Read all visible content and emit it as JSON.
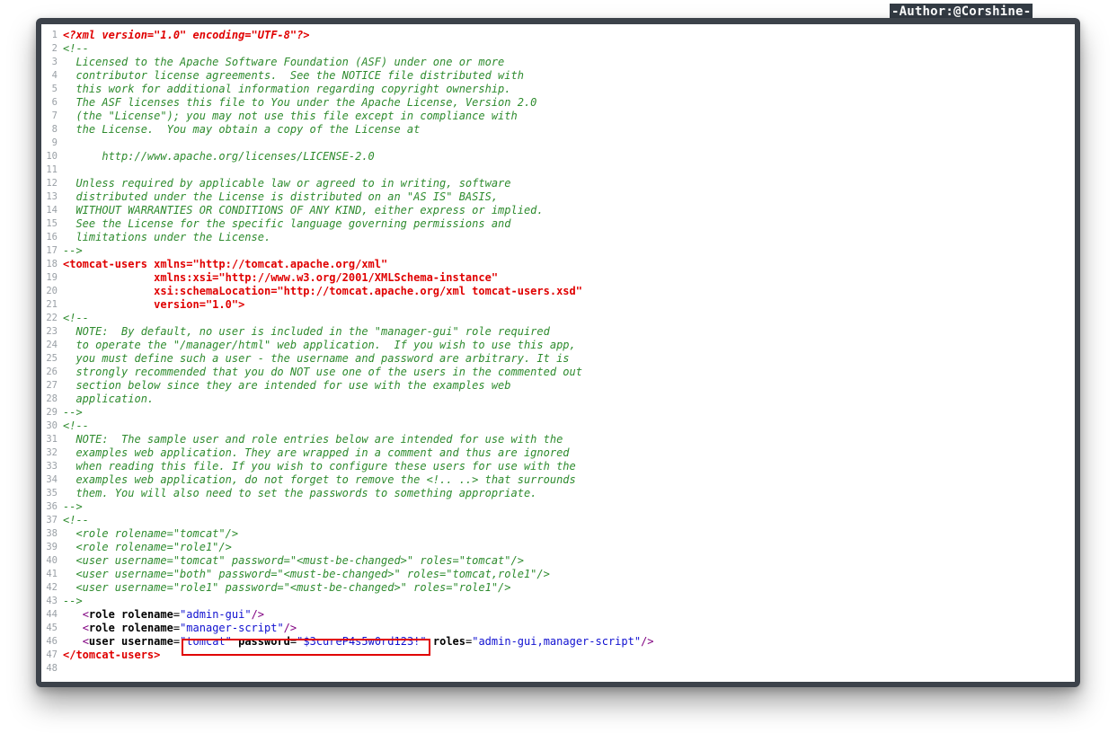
{
  "author_tag": "-Author:@Corshine-",
  "lines": [
    [
      {
        "c": "p",
        "t": "<?xml version=\"1.0\" encoding=\"UTF-8\"?>"
      }
    ],
    [
      {
        "c": "c",
        "t": "<!--"
      }
    ],
    [
      {
        "c": "c",
        "t": "  Licensed to the Apache Software Foundation (ASF) under one or more"
      }
    ],
    [
      {
        "c": "c",
        "t": "  contributor license agreements.  See the NOTICE file distributed with"
      }
    ],
    [
      {
        "c": "c",
        "t": "  this work for additional information regarding copyright ownership."
      }
    ],
    [
      {
        "c": "c",
        "t": "  The ASF licenses this file to You under the Apache License, Version 2.0"
      }
    ],
    [
      {
        "c": "c",
        "t": "  (the \"License\"); you may not use this file except in compliance with"
      }
    ],
    [
      {
        "c": "c",
        "t": "  the License.  You may obtain a copy of the License at"
      }
    ],
    [],
    [
      {
        "c": "c",
        "t": "      http://www.apache.org/licenses/LICENSE-2.0"
      }
    ],
    [],
    [
      {
        "c": "c",
        "t": "  Unless required by applicable law or agreed to in writing, software"
      }
    ],
    [
      {
        "c": "c",
        "t": "  distributed under the License is distributed on an \"AS IS\" BASIS,"
      }
    ],
    [
      {
        "c": "c",
        "t": "  WITHOUT WARRANTIES OR CONDITIONS OF ANY KIND, either express or implied."
      }
    ],
    [
      {
        "c": "c",
        "t": "  See the License for the specific language governing permissions and"
      }
    ],
    [
      {
        "c": "c",
        "t": "  limitations under the License."
      }
    ],
    [
      {
        "c": "c",
        "t": "-->"
      }
    ],
    [
      {
        "c": "t",
        "t": "<tomcat-users xmlns=\"http://tomcat.apache.org/xml\""
      }
    ],
    [
      {
        "c": "t",
        "t": "              xmlns:xsi=\"http://www.w3.org/2001/XMLSchema-instance\""
      }
    ],
    [
      {
        "c": "t",
        "t": "              xsi:schemaLocation=\"http://tomcat.apache.org/xml tomcat-users.xsd\""
      }
    ],
    [
      {
        "c": "t",
        "t": "              version=\"1.0\">"
      }
    ],
    [
      {
        "c": "c",
        "t": "<!--"
      }
    ],
    [
      {
        "c": "c",
        "t": "  NOTE:  By default, no user is included in the \"manager-gui\" role required"
      }
    ],
    [
      {
        "c": "c",
        "t": "  to operate the \"/manager/html\" web application.  If you wish to use this app,"
      }
    ],
    [
      {
        "c": "c",
        "t": "  you must define such a user - the username and password are arbitrary. It is"
      }
    ],
    [
      {
        "c": "c",
        "t": "  strongly recommended that you do NOT use one of the users in the commented out"
      }
    ],
    [
      {
        "c": "c",
        "t": "  section below since they are intended for use with the examples web"
      }
    ],
    [
      {
        "c": "c",
        "t": "  application."
      }
    ],
    [
      {
        "c": "c",
        "t": "-->"
      }
    ],
    [
      {
        "c": "c",
        "t": "<!--"
      }
    ],
    [
      {
        "c": "c",
        "t": "  NOTE:  The sample user and role entries below are intended for use with the"
      }
    ],
    [
      {
        "c": "c",
        "t": "  examples web application. They are wrapped in a comment and thus are ignored"
      }
    ],
    [
      {
        "c": "c",
        "t": "  when reading this file. If you wish to configure these users for use with the"
      }
    ],
    [
      {
        "c": "c",
        "t": "  examples web application, do not forget to remove the <!.. ..> that surrounds"
      }
    ],
    [
      {
        "c": "c",
        "t": "  them. You will also need to set the passwords to something appropriate."
      }
    ],
    [
      {
        "c": "c",
        "t": "-->"
      }
    ],
    [
      {
        "c": "c",
        "t": "<!--"
      }
    ],
    [
      {
        "c": "c",
        "t": "  <role rolename=\"tomcat\"/>"
      }
    ],
    [
      {
        "c": "c",
        "t": "  <role rolename=\"role1\"/>"
      }
    ],
    [
      {
        "c": "c",
        "t": "  <user username=\"tomcat\" password=\"<must-be-changed>\" roles=\"tomcat\"/>"
      }
    ],
    [
      {
        "c": "c",
        "t": "  <user username=\"both\" password=\"<must-be-changed>\" roles=\"tomcat,role1\"/>"
      }
    ],
    [
      {
        "c": "c",
        "t": "  <user username=\"role1\" password=\"<must-be-changed>\" roles=\"role1\"/>"
      }
    ],
    [
      {
        "c": "c",
        "t": "-->"
      }
    ],
    [
      {
        "c": "",
        "t": "   "
      },
      {
        "c": "tg",
        "t": "<"
      },
      {
        "c": "k",
        "t": "role rolename"
      },
      {
        "c": "",
        "t": "="
      },
      {
        "c": "v",
        "t": "\"admin-gui\""
      },
      {
        "c": "tg",
        "t": "/>"
      }
    ],
    [
      {
        "c": "",
        "t": "   "
      },
      {
        "c": "tg",
        "t": "<"
      },
      {
        "c": "k",
        "t": "role rolename"
      },
      {
        "c": "",
        "t": "="
      },
      {
        "c": "v",
        "t": "\"manager-script\""
      },
      {
        "c": "tg",
        "t": "/>"
      }
    ],
    [
      {
        "c": "",
        "t": "   "
      },
      {
        "c": "tg",
        "t": "<"
      },
      {
        "c": "k",
        "t": "user username"
      },
      {
        "c": "",
        "t": "="
      },
      {
        "c": "v",
        "t": "\"tomcat\""
      },
      {
        "c": "",
        "t": " "
      },
      {
        "c": "k",
        "t": "password"
      },
      {
        "c": "",
        "t": "="
      },
      {
        "c": "v",
        "t": "\"$3cureP4s5w0rd123!\""
      },
      {
        "c": "",
        "t": " "
      },
      {
        "c": "k",
        "t": "roles"
      },
      {
        "c": "",
        "t": "="
      },
      {
        "c": "v",
        "t": "\"admin-gui,manager-script\""
      },
      {
        "c": "tg",
        "t": "/>"
      }
    ],
    [
      {
        "c": "t",
        "t": "</tomcat-users>"
      }
    ],
    []
  ]
}
